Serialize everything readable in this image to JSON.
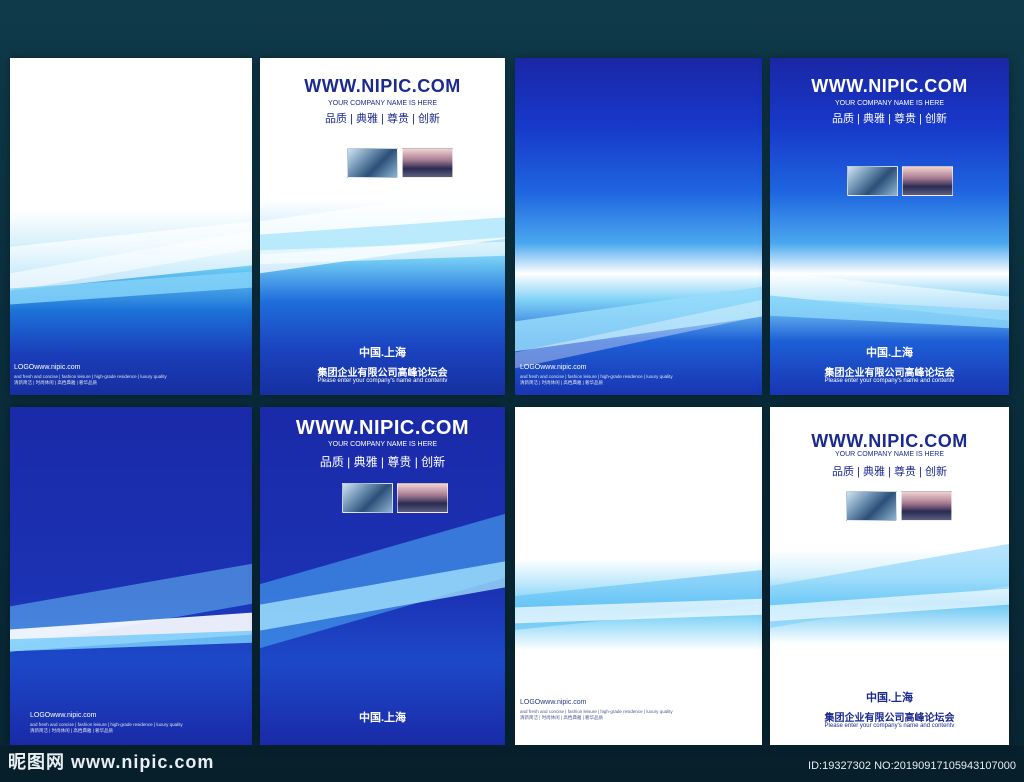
{
  "site": "WWW.NIPIC.COM",
  "company_sub": "YOUR COMPANY NAME IS HERE",
  "tagline": "品质 | 典雅 | 尊贵 | 创新",
  "city": "中国.上海",
  "group_name": "集团企业有限公司高峰论坛会",
  "en_hint": "Please enter your company's name and contentv",
  "logo": "LOGOwww.nipic.com",
  "logo_line1": "and fresh and concise | fashion leisure | high-grade residence | luxury quality",
  "logo_line2": "清新简洁 | 时尚休闲 | 高档典雅 | 奢华品质",
  "watermark_left": "昵图网 www.nipic.com",
  "watermark_right": "ID:19327302 NO:20190917105943107000",
  "colors": {
    "brand_blue": "#1b2a8f",
    "deep_blue": "#1a2aa8",
    "mid_blue": "#1f5fd8",
    "sky": "#7ad4f5",
    "bg_teal": "#0b2f3e"
  }
}
